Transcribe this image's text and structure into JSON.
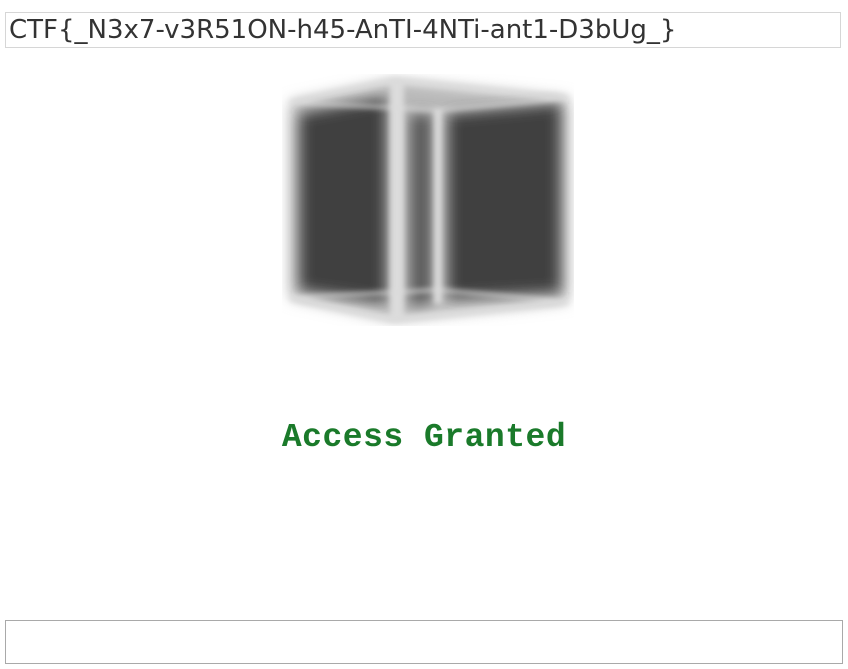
{
  "flag": {
    "text": "CTF{_N3x7-v3R51ON-h45-AnTI-4NTi-ant1-D3bUg_}"
  },
  "cube": {
    "icon": "blurred-3d-cube",
    "face_color": "#3f3f3f",
    "edge_color": "#d8d8d8"
  },
  "status": {
    "text": "Access Granted",
    "color": "#1a7a2a"
  },
  "answer_input": {
    "value": "",
    "placeholder": ""
  }
}
